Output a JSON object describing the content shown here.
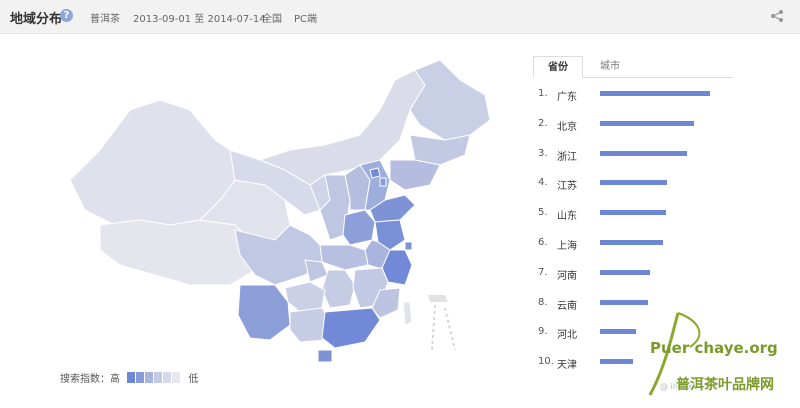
{
  "header": {
    "title": "地域分布",
    "help_icon": "?",
    "keyword": "普洱茶",
    "date_range": "2013-09-01 至 2014-07-14",
    "region": "全国",
    "device": "PC端"
  },
  "tabs": [
    {
      "label": "省份",
      "active": true
    },
    {
      "label": "城市",
      "active": false
    }
  ],
  "ranking": [
    {
      "rank": "1.",
      "name": "广东",
      "level": 1.0
    },
    {
      "rank": "2.",
      "name": "北京",
      "level": 0.85
    },
    {
      "rank": "3.",
      "name": "浙江",
      "level": 0.79
    },
    {
      "rank": "4.",
      "name": "江苏",
      "level": 0.61
    },
    {
      "rank": "5.",
      "name": "山东",
      "level": 0.6
    },
    {
      "rank": "6.",
      "name": "上海",
      "level": 0.57
    },
    {
      "rank": "7.",
      "name": "河南",
      "level": 0.45
    },
    {
      "rank": "8.",
      "name": "云南",
      "level": 0.44
    },
    {
      "rank": "9.",
      "name": "河北",
      "level": 0.33
    },
    {
      "rank": "10.",
      "name": "天津",
      "level": 0.3
    }
  ],
  "legend": {
    "label": "搜索指数：高",
    "low": "低",
    "swatch_colors": [
      "#6e87d4",
      "#8a9cd8",
      "#a8b4df",
      "#c3cae6",
      "#d6d9ec",
      "#e6e7ef"
    ]
  },
  "colors": {
    "accent": "#6e87d4",
    "map_light": "#dde0ec",
    "map_mid": "#b8c0e0",
    "map_dark": "#7189d6",
    "map_lightest": "#e6e6e6"
  },
  "watermark": {
    "brand": "Puer chaye.org",
    "brand_cn": "普洱茶叶品牌网",
    "small": "@ index"
  }
}
